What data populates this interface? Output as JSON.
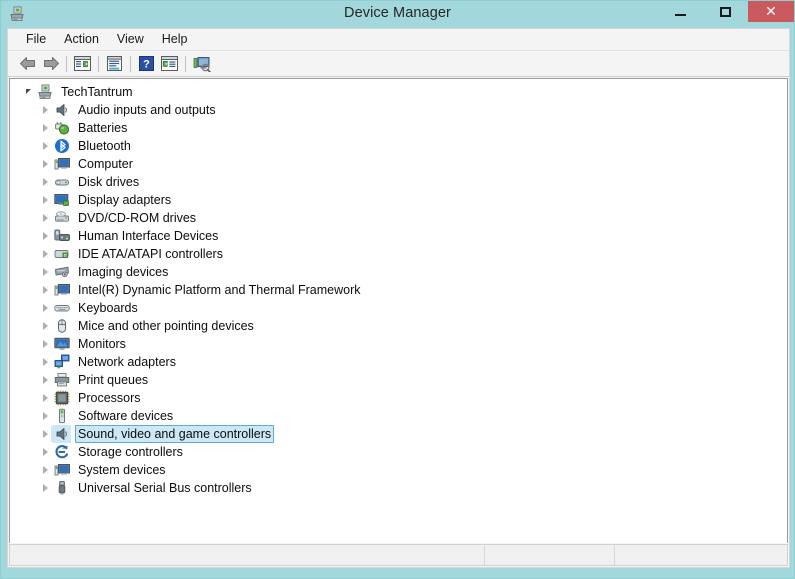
{
  "window": {
    "title": "Device Manager",
    "icon": "computer-printer-icon",
    "accent_titlebar": "#a2d7db",
    "accent_close": "#cb5a5e",
    "selection_fill": "#cce8f6",
    "selection_border": "#5ca9d2",
    "controls": {
      "minimize": "–",
      "maximize": "□",
      "close": "✕"
    }
  },
  "menubar": {
    "items": [
      {
        "label": "File"
      },
      {
        "label": "Action"
      },
      {
        "label": "View"
      },
      {
        "label": "Help"
      }
    ]
  },
  "toolbar": {
    "buttons": [
      {
        "name": "back-button",
        "icon": "arrow-left-icon",
        "separator_after": false
      },
      {
        "name": "forward-button",
        "icon": "arrow-right-icon",
        "separator_after": true
      },
      {
        "name": "show-hide-console-tree-button",
        "icon": "console-tree-icon",
        "separator_after": true
      },
      {
        "name": "properties-button",
        "icon": "properties-window-icon",
        "separator_after": true
      },
      {
        "name": "help-button",
        "icon": "question-mark-icon",
        "separator_after": false
      },
      {
        "name": "update-driver-button",
        "icon": "device-list-icon",
        "separator_after": true
      },
      {
        "name": "scan-for-hardware-changes-button",
        "icon": "scan-hardware-icon",
        "separator_after": false
      }
    ]
  },
  "tree": {
    "root": {
      "label": "TechTantrum",
      "icon": "computer-printer-icon",
      "expanded": true,
      "selected": false
    },
    "nodes": [
      {
        "label": "Audio inputs and outputs",
        "icon": "speaker-icon",
        "expanded": false,
        "selected": false
      },
      {
        "label": "Batteries",
        "icon": "battery-icon",
        "expanded": false,
        "selected": false
      },
      {
        "label": "Bluetooth",
        "icon": "bluetooth-icon",
        "expanded": false,
        "selected": false
      },
      {
        "label": "Computer",
        "icon": "computer-icon",
        "expanded": false,
        "selected": false
      },
      {
        "label": "Disk drives",
        "icon": "disk-drive-icon",
        "expanded": false,
        "selected": false
      },
      {
        "label": "Display adapters",
        "icon": "display-adapter-icon",
        "expanded": false,
        "selected": false
      },
      {
        "label": "DVD/CD-ROM drives",
        "icon": "dvd-drive-icon",
        "expanded": false,
        "selected": false
      },
      {
        "label": "Human Interface Devices",
        "icon": "hid-icon",
        "expanded": false,
        "selected": false
      },
      {
        "label": "IDE ATA/ATAPI controllers",
        "icon": "ide-controller-icon",
        "expanded": false,
        "selected": false
      },
      {
        "label": "Imaging devices",
        "icon": "imaging-device-icon",
        "expanded": false,
        "selected": false
      },
      {
        "label": "Intel(R) Dynamic Platform and Thermal Framework",
        "icon": "computer-icon",
        "expanded": false,
        "selected": false
      },
      {
        "label": "Keyboards",
        "icon": "keyboard-icon",
        "expanded": false,
        "selected": false
      },
      {
        "label": "Mice and other pointing devices",
        "icon": "mouse-icon",
        "expanded": false,
        "selected": false
      },
      {
        "label": "Monitors",
        "icon": "monitor-icon",
        "expanded": false,
        "selected": false
      },
      {
        "label": "Network adapters",
        "icon": "network-adapter-icon",
        "expanded": false,
        "selected": false
      },
      {
        "label": "Print queues",
        "icon": "printer-icon",
        "expanded": false,
        "selected": false
      },
      {
        "label": "Processors",
        "icon": "processor-icon",
        "expanded": false,
        "selected": false
      },
      {
        "label": "Software devices",
        "icon": "software-device-icon",
        "expanded": false,
        "selected": false
      },
      {
        "label": "Sound, video and game controllers",
        "icon": "speaker-icon",
        "expanded": false,
        "selected": true
      },
      {
        "label": "Storage controllers",
        "icon": "storage-controller-icon",
        "expanded": false,
        "selected": false
      },
      {
        "label": "System devices",
        "icon": "computer-icon",
        "expanded": false,
        "selected": false
      },
      {
        "label": "Universal Serial Bus controllers",
        "icon": "usb-controller-icon",
        "expanded": false,
        "selected": false
      }
    ]
  },
  "statusbar": {
    "main": "",
    "middle": "",
    "end": ""
  }
}
